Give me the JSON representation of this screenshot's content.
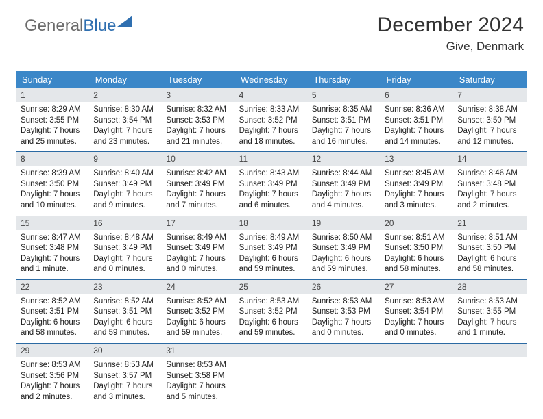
{
  "brand": {
    "part1": "General",
    "part2": "Blue"
  },
  "header": {
    "title": "December 2024",
    "location": "Give, Denmark"
  },
  "weekdays": [
    "Sunday",
    "Monday",
    "Tuesday",
    "Wednesday",
    "Thursday",
    "Friday",
    "Saturday"
  ],
  "chart_data": {
    "type": "table",
    "title": "Sunrise, Sunset, and Daylight — December 2024 — Give, Denmark",
    "columns": [
      "date",
      "sunrise",
      "sunset",
      "daylight"
    ],
    "rows": [
      {
        "date": 1,
        "sunrise": "8:29 AM",
        "sunset": "3:55 PM",
        "daylight": "7 hours and 25 minutes"
      },
      {
        "date": 2,
        "sunrise": "8:30 AM",
        "sunset": "3:54 PM",
        "daylight": "7 hours and 23 minutes"
      },
      {
        "date": 3,
        "sunrise": "8:32 AM",
        "sunset": "3:53 PM",
        "daylight": "7 hours and 21 minutes"
      },
      {
        "date": 4,
        "sunrise": "8:33 AM",
        "sunset": "3:52 PM",
        "daylight": "7 hours and 18 minutes"
      },
      {
        "date": 5,
        "sunrise": "8:35 AM",
        "sunset": "3:51 PM",
        "daylight": "7 hours and 16 minutes"
      },
      {
        "date": 6,
        "sunrise": "8:36 AM",
        "sunset": "3:51 PM",
        "daylight": "7 hours and 14 minutes"
      },
      {
        "date": 7,
        "sunrise": "8:38 AM",
        "sunset": "3:50 PM",
        "daylight": "7 hours and 12 minutes"
      },
      {
        "date": 8,
        "sunrise": "8:39 AM",
        "sunset": "3:50 PM",
        "daylight": "7 hours and 10 minutes"
      },
      {
        "date": 9,
        "sunrise": "8:40 AM",
        "sunset": "3:49 PM",
        "daylight": "7 hours and 9 minutes"
      },
      {
        "date": 10,
        "sunrise": "8:42 AM",
        "sunset": "3:49 PM",
        "daylight": "7 hours and 7 minutes"
      },
      {
        "date": 11,
        "sunrise": "8:43 AM",
        "sunset": "3:49 PM",
        "daylight": "7 hours and 6 minutes"
      },
      {
        "date": 12,
        "sunrise": "8:44 AM",
        "sunset": "3:49 PM",
        "daylight": "7 hours and 4 minutes"
      },
      {
        "date": 13,
        "sunrise": "8:45 AM",
        "sunset": "3:49 PM",
        "daylight": "7 hours and 3 minutes"
      },
      {
        "date": 14,
        "sunrise": "8:46 AM",
        "sunset": "3:48 PM",
        "daylight": "7 hours and 2 minutes"
      },
      {
        "date": 15,
        "sunrise": "8:47 AM",
        "sunset": "3:48 PM",
        "daylight": "7 hours and 1 minute"
      },
      {
        "date": 16,
        "sunrise": "8:48 AM",
        "sunset": "3:49 PM",
        "daylight": "7 hours and 0 minutes"
      },
      {
        "date": 17,
        "sunrise": "8:49 AM",
        "sunset": "3:49 PM",
        "daylight": "7 hours and 0 minutes"
      },
      {
        "date": 18,
        "sunrise": "8:49 AM",
        "sunset": "3:49 PM",
        "daylight": "6 hours and 59 minutes"
      },
      {
        "date": 19,
        "sunrise": "8:50 AM",
        "sunset": "3:49 PM",
        "daylight": "6 hours and 59 minutes"
      },
      {
        "date": 20,
        "sunrise": "8:51 AM",
        "sunset": "3:50 PM",
        "daylight": "6 hours and 58 minutes"
      },
      {
        "date": 21,
        "sunrise": "8:51 AM",
        "sunset": "3:50 PM",
        "daylight": "6 hours and 58 minutes"
      },
      {
        "date": 22,
        "sunrise": "8:52 AM",
        "sunset": "3:51 PM",
        "daylight": "6 hours and 58 minutes"
      },
      {
        "date": 23,
        "sunrise": "8:52 AM",
        "sunset": "3:51 PM",
        "daylight": "6 hours and 59 minutes"
      },
      {
        "date": 24,
        "sunrise": "8:52 AM",
        "sunset": "3:52 PM",
        "daylight": "6 hours and 59 minutes"
      },
      {
        "date": 25,
        "sunrise": "8:53 AM",
        "sunset": "3:52 PM",
        "daylight": "6 hours and 59 minutes"
      },
      {
        "date": 26,
        "sunrise": "8:53 AM",
        "sunset": "3:53 PM",
        "daylight": "7 hours and 0 minutes"
      },
      {
        "date": 27,
        "sunrise": "8:53 AM",
        "sunset": "3:54 PM",
        "daylight": "7 hours and 0 minutes"
      },
      {
        "date": 28,
        "sunrise": "8:53 AM",
        "sunset": "3:55 PM",
        "daylight": "7 hours and 1 minute"
      },
      {
        "date": 29,
        "sunrise": "8:53 AM",
        "sunset": "3:56 PM",
        "daylight": "7 hours and 2 minutes"
      },
      {
        "date": 30,
        "sunrise": "8:53 AM",
        "sunset": "3:57 PM",
        "daylight": "7 hours and 3 minutes"
      },
      {
        "date": 31,
        "sunrise": "8:53 AM",
        "sunset": "3:58 PM",
        "daylight": "7 hours and 5 minutes"
      }
    ]
  },
  "labels": {
    "sunrise_prefix": "Sunrise: ",
    "sunset_prefix": "Sunset: ",
    "daylight_prefix": "Daylight: "
  },
  "calendar": {
    "start_weekday": 0,
    "days_in_month": 31
  }
}
